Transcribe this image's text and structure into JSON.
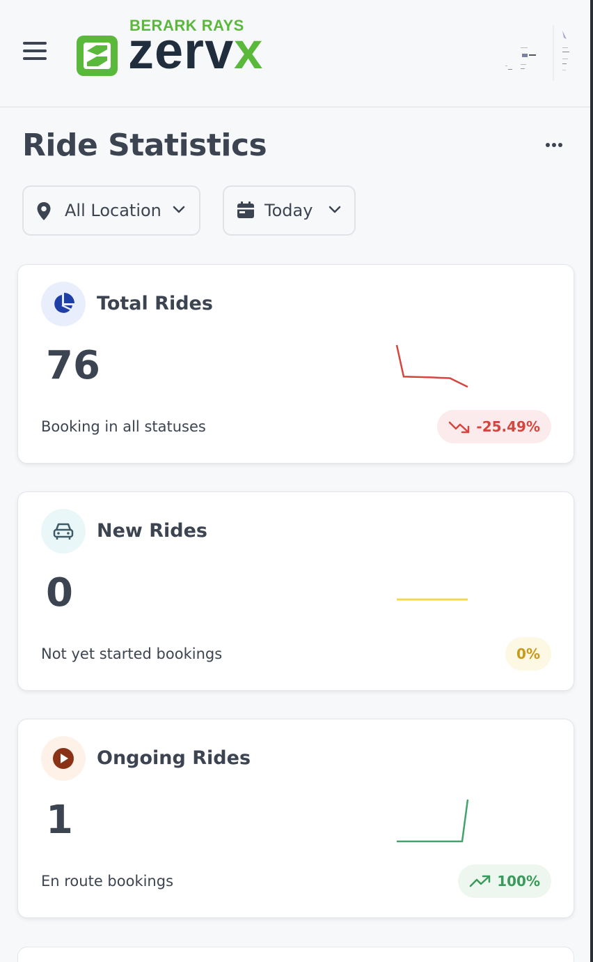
{
  "header": {
    "brand_sub": "BERARK RAYS",
    "brand_word_main": "zerv",
    "brand_word_accent": "x"
  },
  "page": {
    "title": "Ride Statistics"
  },
  "filters": {
    "location": "All Location",
    "period": "Today"
  },
  "colors": {
    "brand_green": "#5ab83a",
    "brand_navy": "#1f2d3d",
    "down_red": "#d6453d",
    "neutral_yellow": "#f2d94e",
    "up_green": "#3fa46a"
  },
  "cards": [
    {
      "title": "Total Rides",
      "value": "76",
      "description": "Booking in all statuses",
      "change": "-25.49%",
      "trend": "down",
      "icon": "pie-chart-icon",
      "sparkline": [
        100,
        60,
        59,
        58,
        47
      ]
    },
    {
      "title": "New Rides",
      "value": "0",
      "description": "Not yet started bookings",
      "change": "0%",
      "trend": "flat",
      "icon": "car-icon",
      "sparkline": [
        0,
        0,
        0,
        0,
        0
      ]
    },
    {
      "title": "Ongoing Rides",
      "value": "1",
      "description": "En route bookings",
      "change": "100%",
      "trend": "up",
      "icon": "play-icon",
      "sparkline": [
        0,
        0,
        0,
        0,
        1
      ]
    }
  ]
}
